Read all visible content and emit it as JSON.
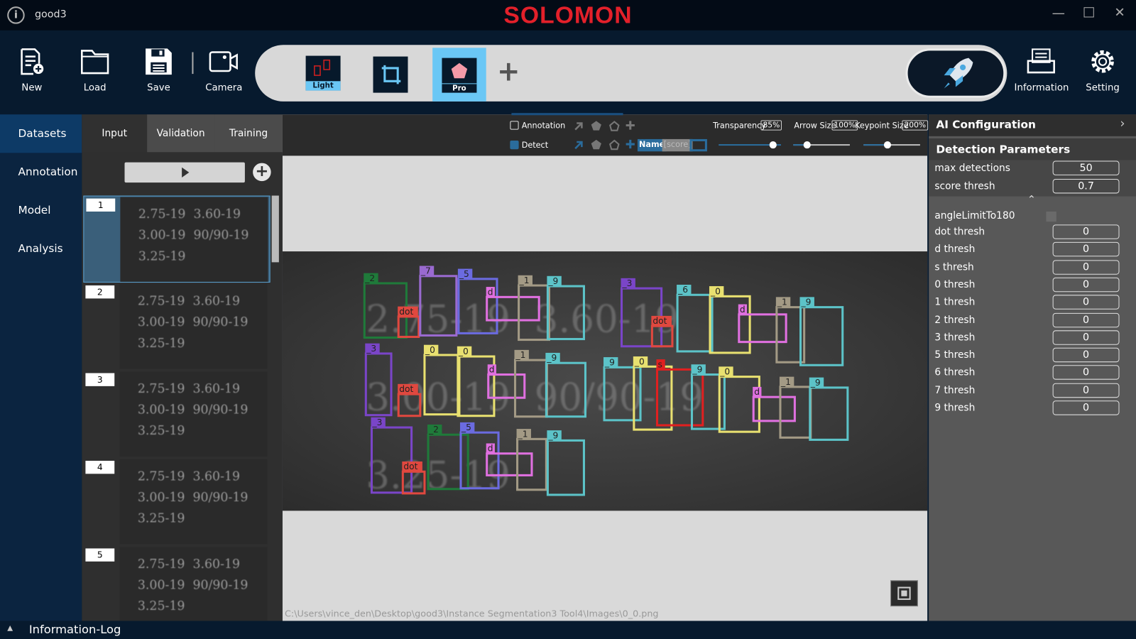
{
  "window": {
    "title": "good3",
    "logo": "SOLOMON",
    "icons": [
      "info-icon",
      "minimize-icon",
      "maximize-icon",
      "close-icon"
    ]
  },
  "toolbar": {
    "new": "New",
    "load": "Load",
    "save": "Save",
    "camera": "Camera",
    "information": "Information",
    "setting": "Setting",
    "modes": [
      {
        "label": "Light",
        "active": false
      },
      {
        "label": "",
        "icon": "crop-icon"
      },
      {
        "label": "Pro",
        "active": true
      }
    ],
    "add": "+"
  },
  "nav": {
    "items": [
      "Datasets",
      "Annotation",
      "Model",
      "Analysis"
    ],
    "selected": "Datasets"
  },
  "datasets": {
    "tabs": [
      "Input",
      "Validation",
      "Training"
    ],
    "active_tab": "Input",
    "thumbnails": [
      {
        "num": "1",
        "selected": true
      },
      {
        "num": "2"
      },
      {
        "num": "3"
      },
      {
        "num": "4"
      },
      {
        "num": "5"
      }
    ],
    "image_text": "2.75-19  3.60-19\n3.00-19  90/90-19\n3.25-19"
  },
  "viewer": {
    "annotation_label": "Annotation",
    "annotation_checked": false,
    "detect_label": "Detect",
    "detect_checked": true,
    "name_label": "Name",
    "score_label": "[score]",
    "transparency_label": "Transparency",
    "transparency": "85%",
    "arrow_size_label": "Arrow Size",
    "arrow_size": "100%",
    "keypoint_size_label": "Keypoint Size",
    "keypoint_size": "200%",
    "path": "C:\\Users\\vince_den\\Desktop\\good3\\Instance Segmentation3 Tool4\\Images\\0_0.png",
    "detection_labels": [
      "_2",
      "dot",
      "_7",
      "_5",
      "d",
      "_1",
      "_9",
      "_3",
      "dot",
      "_0",
      "_0",
      "d",
      "_1",
      "_9",
      "_3",
      "dot",
      "_2",
      "_5",
      "d",
      "_1",
      "_9",
      "_3",
      "dot",
      "_6",
      "_0",
      "d",
      "_1",
      "_9",
      "_9",
      "_0",
      "s",
      "_9",
      "_0",
      "d",
      "_1",
      "_9"
    ],
    "class_colors": {
      "_0": "#e8e070",
      "_1": "#a39a85",
      "_2": "#1f7a3a",
      "_3": "#7a45c8",
      "_5": "#6b6be0",
      "_6": "#5cc3c8",
      "_7": "#9a6ad0",
      "_9": "#5cc3c8",
      "d": "#e070e0",
      "dot": "#e0483f",
      "s": "#e02020"
    }
  },
  "config": {
    "title": "AI Configuration",
    "section": "Detection Parameters",
    "params": [
      {
        "label": "max detections",
        "value": "50"
      },
      {
        "label": "score thresh",
        "value": "0.7"
      }
    ],
    "angle_label": "angleLimitTo180",
    "angle_checked": false,
    "thresholds": [
      {
        "label": "dot thresh",
        "value": "0"
      },
      {
        "label": "d thresh",
        "value": "0"
      },
      {
        "label": "s thresh",
        "value": "0"
      },
      {
        "label": "0 thresh",
        "value": "0"
      },
      {
        "label": "1 thresh",
        "value": "0"
      },
      {
        "label": "2 thresh",
        "value": "0"
      },
      {
        "label": "3 thresh",
        "value": "0"
      },
      {
        "label": "5 thresh",
        "value": "0"
      },
      {
        "label": "6 thresh",
        "value": "0"
      },
      {
        "label": "7 thresh",
        "value": "0"
      },
      {
        "label": "9 thresh",
        "value": "0"
      }
    ]
  },
  "footer": {
    "log_label": "Information-Log"
  }
}
